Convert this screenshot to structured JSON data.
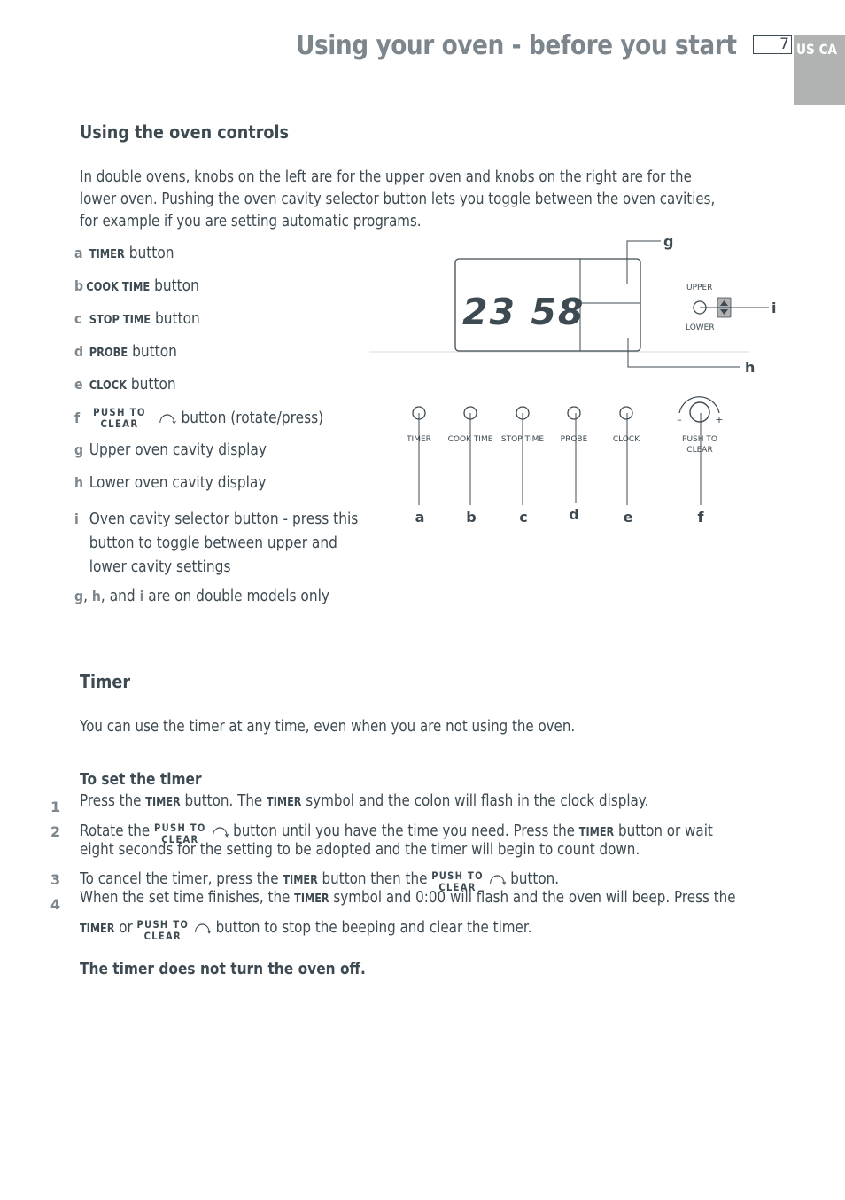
{
  "header": {
    "title": "Using your oven - before you start",
    "page_number": "7",
    "region": "US CA"
  },
  "controls_section": {
    "heading": "Using the oven controls",
    "intro": [
      "In double ovens, knobs on the left are for the upper oven and knobs on the right are for the",
      "lower oven. Pushing the oven cavity selector button lets you toggle between the oven cavities,",
      "for example if you are setting automatic programs."
    ],
    "legend": [
      {
        "letter": "a",
        "key": "TIMER",
        "text": "button"
      },
      {
        "letter": "b",
        "key": "COOK TIME",
        "text": "button"
      },
      {
        "letter": "c",
        "key": "STOP TIME",
        "text": "button"
      },
      {
        "letter": "d",
        "key": "PROBE",
        "text": "button"
      },
      {
        "letter": "e",
        "key": "CLOCK",
        "text": "button"
      },
      {
        "letter": "f",
        "key_line1": "PUSH TO",
        "key_line2": "CLEAR",
        "icon": "rotate-arc-icon",
        "text": "button (rotate/press)"
      },
      {
        "letter": "g",
        "text": "Upper oven cavity display"
      },
      {
        "letter": "h",
        "text": "Lower oven cavity display"
      },
      {
        "letter": "i",
        "lines": [
          "Oven cavity selector button - press this",
          "button to toggle between upper and",
          "lower cavity settings"
        ]
      }
    ],
    "footnote": {
      "g": "g",
      "h": "h",
      "i": "i",
      "sep1": ", ",
      "sep2": ", and ",
      "rest": " are on double models only"
    }
  },
  "diagram": {
    "display_digits": "23 58",
    "callouts": {
      "g": "g",
      "h": "h",
      "i": "i"
    },
    "selector": {
      "upper": "UPPER",
      "lower": "LOWER"
    },
    "buttons": [
      {
        "label": "TIMER",
        "letter": "a"
      },
      {
        "label": "COOK TIME",
        "letter": "b"
      },
      {
        "label": "STOP TIME",
        "letter": "c"
      },
      {
        "label": "PROBE",
        "letter": "d"
      },
      {
        "label": "CLOCK",
        "letter": "e"
      }
    ],
    "knob": {
      "label_line1": "PUSH TO",
      "label_line2": "CLEAR",
      "letter": "f",
      "minus": "–",
      "plus": "+"
    }
  },
  "timer_section": {
    "heading": "Timer",
    "intro": "You can use the timer at any time, even when you are not using the oven.",
    "subheading": "To set the timer",
    "ptc_line1": "PUSH TO",
    "ptc_line2": "CLEAR",
    "timer_key": "TIMER",
    "steps": [
      {
        "num": "1",
        "a": "Press the ",
        "b": " button.  The ",
        "c": " symbol and the colon will flash in the clock display."
      },
      {
        "num": "2",
        "a": "Rotate the ",
        "b": " button until you have the time you need.  Press the ",
        "c": " button or wait",
        "d": "eight seconds for the setting to be adopted and the timer will begin to count down."
      },
      {
        "num": "3",
        "a": "To cancel the timer, press the ",
        "b": " button then the ",
        "c": " button."
      },
      {
        "num": "4",
        "a": "When the set time finishes, the ",
        "b": " symbol and 0:00 will flash and the oven will beep. Press the",
        "c": " or ",
        "d": " button to stop the beeping and clear the timer."
      }
    ],
    "note": "The timer does not turn the oven off."
  }
}
